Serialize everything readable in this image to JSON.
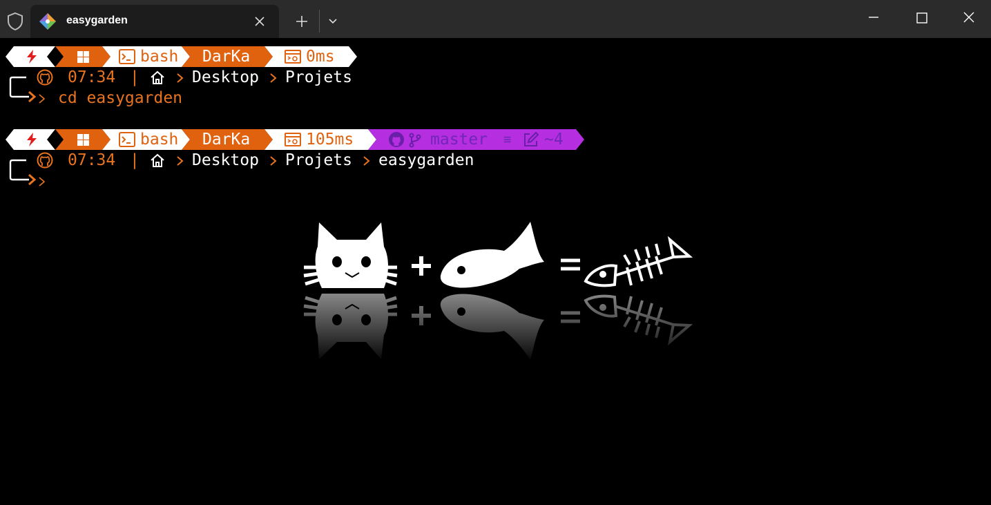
{
  "window": {
    "tab_title": "easygarden",
    "icons": {
      "shield": "shield-icon",
      "tab": "git-icon",
      "close": "close-icon",
      "new_tab": "plus-icon",
      "dropdown": "chevron-down-icon",
      "minimize": "minimize-icon",
      "maximize": "maximize-icon",
      "window_close": "close-icon"
    }
  },
  "colors": {
    "orange": "#e0620f",
    "purple": "#b52ee0",
    "white": "#ffffff",
    "bolt_red": "#e51c1c",
    "title_bar": "#2b2b2b",
    "terminal_bg": "#000000"
  },
  "prompts": [
    {
      "powerline": {
        "os_icon": "windows-icon",
        "shell_icon": "terminal-icon",
        "shell": "bash",
        "user": "DarKa",
        "exec_icon": "execution-time-icon",
        "exec_time": "0ms"
      },
      "time": "07:34",
      "separator": "|",
      "path": [
        "Desktop",
        "Projets"
      ],
      "command": "cd easygarden"
    },
    {
      "powerline": {
        "os_icon": "windows-icon",
        "shell_icon": "terminal-icon",
        "shell": "bash",
        "user": "DarKa",
        "exec_icon": "execution-time-icon",
        "exec_time": "105ms",
        "git": {
          "github_icon": "github-icon",
          "branch_icon": "git-branch-icon",
          "branch": "master",
          "status_symbol": "≡",
          "edit_icon": "edit-icon",
          "changes": "~4"
        }
      },
      "time": "07:34",
      "separator": "|",
      "path": [
        "Desktop",
        "Projets",
        "easygarden"
      ],
      "command": ""
    }
  ],
  "wallpaper": {
    "description_icons": [
      "cat-icon",
      "plus-sign",
      "fish-icon",
      "equals-sign",
      "fish-skeleton-icon"
    ]
  }
}
